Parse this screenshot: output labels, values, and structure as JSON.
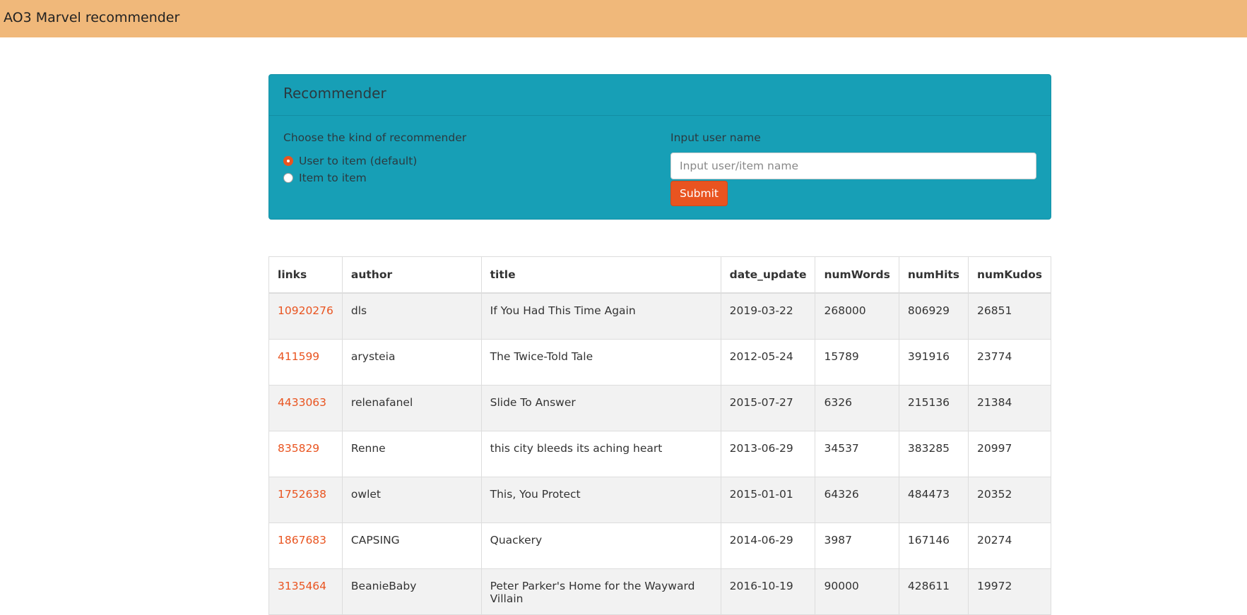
{
  "header": {
    "title": "AO3 Marvel recommender",
    "bg_color": "#f0b87a"
  },
  "panel": {
    "title": "Recommender",
    "bg_color": "#179fb6",
    "recommender_label": "Choose the kind of recommender",
    "options": [
      {
        "label": "User to item (default)",
        "checked": true
      },
      {
        "label": "Item to item",
        "checked": false
      }
    ],
    "input_label": "Input user name",
    "input_placeholder": "Input user/item name",
    "input_value": "",
    "submit_label": "Submit",
    "accent_color": "#e95420"
  },
  "table": {
    "columns": [
      "links",
      "author",
      "title",
      "date_update",
      "numWords",
      "numHits",
      "numKudos"
    ],
    "rows": [
      {
        "link": "10920276",
        "author": "dls",
        "title": "If You Had This Time Again",
        "date_update": "2019-03-22",
        "numWords": "268000",
        "numHits": "806929",
        "numKudos": "26851"
      },
      {
        "link": "411599",
        "author": "arysteia",
        "title": "The Twice-Told Tale",
        "date_update": "2012-05-24",
        "numWords": "15789",
        "numHits": "391916",
        "numKudos": "23774"
      },
      {
        "link": "4433063",
        "author": "relenafanel",
        "title": "Slide To Answer",
        "date_update": "2015-07-27",
        "numWords": "6326",
        "numHits": "215136",
        "numKudos": "21384"
      },
      {
        "link": "835829",
        "author": "Renne",
        "title": "this city bleeds its aching heart",
        "date_update": "2013-06-29",
        "numWords": "34537",
        "numHits": "383285",
        "numKudos": "20997"
      },
      {
        "link": "1752638",
        "author": "owlet",
        "title": "This, You Protect",
        "date_update": "2015-01-01",
        "numWords": "64326",
        "numHits": "484473",
        "numKudos": "20352"
      },
      {
        "link": "1867683",
        "author": "CAPSING",
        "title": "Quackery",
        "date_update": "2014-06-29",
        "numWords": "3987",
        "numHits": "167146",
        "numKudos": "20274"
      },
      {
        "link": "3135464",
        "author": "BeanieBaby",
        "title": "Peter Parker's Home for the Wayward Villain",
        "date_update": "2016-10-19",
        "numWords": "90000",
        "numHits": "428611",
        "numKudos": "19972"
      }
    ]
  }
}
